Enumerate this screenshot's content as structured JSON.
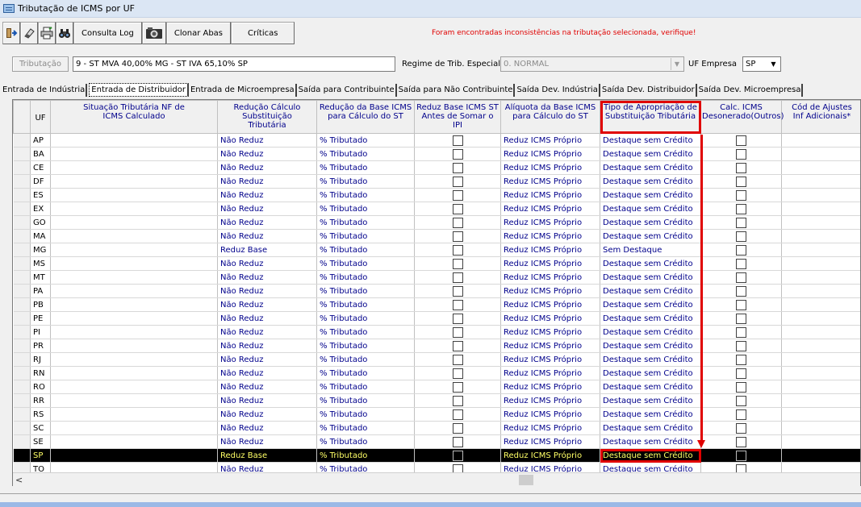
{
  "window": {
    "title": "Tributação de ICMS por UF"
  },
  "toolbar": {
    "icons": [
      "exit-icon",
      "eraser-icon",
      "printer-icon",
      "binoculars-icon",
      "camera-icon"
    ],
    "consulta_log": "Consulta Log",
    "clonar_abas": "Clonar Abas",
    "criticas": "Críticas"
  },
  "warning": "Foram encontradas inconsistências na tributação selecionada, verifique!",
  "filters": {
    "tributacao_label": "Tributação",
    "tributacao_value": "9 - ST MVA 40,00% MG - ST IVA 65,10% SP",
    "regime_label": "Regime de Trib. Especial",
    "regime_value": "0. NORMAL",
    "uf_empresa_label": "UF Empresa",
    "uf_empresa_value": "SP"
  },
  "tabs": [
    {
      "label": "Entrada de Indústria",
      "active": false
    },
    {
      "label": "Entrada de Distribuidor",
      "active": true
    },
    {
      "label": "Entrada de Microempresa",
      "active": false
    },
    {
      "label": "Saída para Contribuinte",
      "active": false
    },
    {
      "label": "Saída para Não Contribuinte",
      "active": false
    },
    {
      "label": "Saída Dev. Indústria",
      "active": false
    },
    {
      "label": "Saída Dev. Distribuidor",
      "active": false
    },
    {
      "label": "Saída Dev. Microempresa",
      "active": false
    }
  ],
  "grid": {
    "headers": {
      "uf": "UF",
      "situacao": "Situação Tributária NF de ICMS Calculado",
      "reducao_calc": "Redução Cálculo Substituição Tributária",
      "reducao_base": "Redução da Base ICMS para Cálculo do ST",
      "reduz_base": "Reduz Base ICMS ST Antes de Somar o IPI",
      "aliquota": "Alíquota da Base ICMS para Cálculo do ST",
      "tipo_apropriacao": "Tipo de Apropriação de Substituição Tributária",
      "calc_icms": "Calc. ICMS Desonerado(Outros)",
      "cod_ajustes": "Cód de Ajustes Inf Adicionais*"
    },
    "rows": [
      {
        "uf": "AP",
        "reducao_calc": "Não Reduz",
        "reducao_base": "% Tributado",
        "aliquota": "Reduz ICMS Próprio",
        "tipo": "Destaque sem Crédito"
      },
      {
        "uf": "BA",
        "reducao_calc": "Não Reduz",
        "reducao_base": "% Tributado",
        "aliquota": "Reduz ICMS Próprio",
        "tipo": "Destaque sem Crédito"
      },
      {
        "uf": "CE",
        "reducao_calc": "Não Reduz",
        "reducao_base": "% Tributado",
        "aliquota": "Reduz ICMS Próprio",
        "tipo": "Destaque sem Crédito"
      },
      {
        "uf": "DF",
        "reducao_calc": "Não Reduz",
        "reducao_base": "% Tributado",
        "aliquota": "Reduz ICMS Próprio",
        "tipo": "Destaque sem Crédito"
      },
      {
        "uf": "ES",
        "reducao_calc": "Não Reduz",
        "reducao_base": "% Tributado",
        "aliquota": "Reduz ICMS Próprio",
        "tipo": "Destaque sem Crédito"
      },
      {
        "uf": "EX",
        "reducao_calc": "Não Reduz",
        "reducao_base": "% Tributado",
        "aliquota": "Reduz ICMS Próprio",
        "tipo": "Destaque sem Crédito"
      },
      {
        "uf": "GO",
        "reducao_calc": "Não Reduz",
        "reducao_base": "% Tributado",
        "aliquota": "Reduz ICMS Próprio",
        "tipo": "Destaque sem Crédito"
      },
      {
        "uf": "MA",
        "reducao_calc": "Não Reduz",
        "reducao_base": "% Tributado",
        "aliquota": "Reduz ICMS Próprio",
        "tipo": "Destaque sem Crédito"
      },
      {
        "uf": "MG",
        "reducao_calc": "Reduz Base",
        "reducao_base": "% Tributado",
        "aliquota": "Reduz ICMS Próprio",
        "tipo": "Sem Destaque"
      },
      {
        "uf": "MS",
        "reducao_calc": "Não Reduz",
        "reducao_base": "% Tributado",
        "aliquota": "Reduz ICMS Próprio",
        "tipo": "Destaque sem Crédito"
      },
      {
        "uf": "MT",
        "reducao_calc": "Não Reduz",
        "reducao_base": "% Tributado",
        "aliquota": "Reduz ICMS Próprio",
        "tipo": "Destaque sem Crédito"
      },
      {
        "uf": "PA",
        "reducao_calc": "Não Reduz",
        "reducao_base": "% Tributado",
        "aliquota": "Reduz ICMS Próprio",
        "tipo": "Destaque sem Crédito"
      },
      {
        "uf": "PB",
        "reducao_calc": "Não Reduz",
        "reducao_base": "% Tributado",
        "aliquota": "Reduz ICMS Próprio",
        "tipo": "Destaque sem Crédito"
      },
      {
        "uf": "PE",
        "reducao_calc": "Não Reduz",
        "reducao_base": "% Tributado",
        "aliquota": "Reduz ICMS Próprio",
        "tipo": "Destaque sem Crédito"
      },
      {
        "uf": "PI",
        "reducao_calc": "Não Reduz",
        "reducao_base": "% Tributado",
        "aliquota": "Reduz ICMS Próprio",
        "tipo": "Destaque sem Crédito"
      },
      {
        "uf": "PR",
        "reducao_calc": "Não Reduz",
        "reducao_base": "% Tributado",
        "aliquota": "Reduz ICMS Próprio",
        "tipo": "Destaque sem Crédito"
      },
      {
        "uf": "RJ",
        "reducao_calc": "Não Reduz",
        "reducao_base": "% Tributado",
        "aliquota": "Reduz ICMS Próprio",
        "tipo": "Destaque sem Crédito"
      },
      {
        "uf": "RN",
        "reducao_calc": "Não Reduz",
        "reducao_base": "% Tributado",
        "aliquota": "Reduz ICMS Próprio",
        "tipo": "Destaque sem Crédito"
      },
      {
        "uf": "RO",
        "reducao_calc": "Não Reduz",
        "reducao_base": "% Tributado",
        "aliquota": "Reduz ICMS Próprio",
        "tipo": "Destaque sem Crédito"
      },
      {
        "uf": "RR",
        "reducao_calc": "Não Reduz",
        "reducao_base": "% Tributado",
        "aliquota": "Reduz ICMS Próprio",
        "tipo": "Destaque sem Crédito"
      },
      {
        "uf": "RS",
        "reducao_calc": "Não Reduz",
        "reducao_base": "% Tributado",
        "aliquota": "Reduz ICMS Próprio",
        "tipo": "Destaque sem Crédito"
      },
      {
        "uf": "SC",
        "reducao_calc": "Não Reduz",
        "reducao_base": "% Tributado",
        "aliquota": "Reduz ICMS Próprio",
        "tipo": "Destaque sem Crédito"
      },
      {
        "uf": "SE",
        "reducao_calc": "Não Reduz",
        "reducao_base": "% Tributado",
        "aliquota": "Reduz ICMS Próprio",
        "tipo": "Destaque sem Crédito"
      },
      {
        "uf": "SP",
        "reducao_calc": "Reduz Base",
        "reducao_base": "% Tributado",
        "aliquota": "Reduz ICMS Próprio",
        "tipo": "Destaque sem Crédito",
        "selected": true
      },
      {
        "uf": "TO",
        "reducao_calc": "Não Reduz",
        "reducao_base": "% Tributado",
        "aliquota": "Reduz ICMS Próprio",
        "tipo": "Destaque sem Crédito"
      }
    ]
  },
  "colors": {
    "highlight_red": "#e00000",
    "cell_text_blue": "#00008b",
    "selected_row_text": "#ffff66"
  }
}
